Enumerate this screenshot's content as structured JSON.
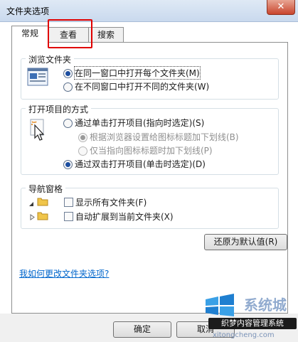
{
  "window": {
    "title": "文件夹选项",
    "close_label": "✕"
  },
  "tabs": [
    {
      "label": "常规",
      "active": true
    },
    {
      "label": "查看",
      "active": false,
      "highlighted": true
    },
    {
      "label": "搜索",
      "active": false
    }
  ],
  "browse": {
    "title": "浏览文件夹",
    "option_same": "在同一窗口中打开每个文件夹(M)",
    "option_new": "在不同窗口中打开不同的文件夹(W)",
    "selected": "same"
  },
  "click": {
    "title": "打开项目的方式",
    "option_single": "通过单击打开项目(指向时选定)(S)",
    "sub_browser": "根据浏览器设置给图标标题加下划线(B)",
    "sub_point": "仅当指向图标标题时加下划线(P)",
    "option_double": "通过双击打开项目(单击时选定)(D)",
    "selected": "double"
  },
  "nav": {
    "title": "导航窗格",
    "show_all": "显示所有文件夹(F)",
    "auto_expand": "自动扩展到当前文件夹(X)"
  },
  "restore_defaults": "还原为默认值(R)",
  "help_link": "我如何更改文件夹选项?",
  "footer": {
    "ok": "确定",
    "cancel": "取消"
  },
  "watermark": {
    "text": "系统城",
    "badge": "织梦内容管理系统",
    "url": "xitongcheng.com"
  },
  "colors": {
    "highlight_outline": "#e00000",
    "link": "#0066cc"
  }
}
